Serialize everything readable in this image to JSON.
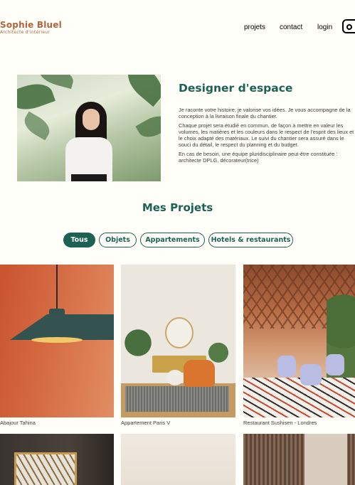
{
  "header": {
    "brand": "Sophie Bluel",
    "brand_subtitle": "Architecte d'intérieur",
    "nav": [
      "projets",
      "contact",
      "login"
    ],
    "social_icon": "instagram-icon"
  },
  "intro": {
    "title": "Designer d'espace",
    "paragraphs": [
      "Je raconte votre histoire, je valorise vos idées. Je vous accompagne de la conception à la livraison finale du chantier.",
      "Chaque projet sera étudié en commun, de façon à mettre en valeur les volumes, les matières et les couleurs dans le respect de l'esprit des lieux et le choix adapté des matériaux. Le suivi du chantier sera assuré dans le souci du détail, le respect du planning et du budget.",
      "En cas de besoin, une équipe pluridisciplinaire peut-être constituée : architecte DPLG, décorateur(trice)"
    ]
  },
  "projects": {
    "title": "Mes Projets",
    "filters": [
      "Tous",
      "Objets",
      "Appartements",
      "Hotels & restaurants"
    ],
    "active_filter": "Tous",
    "items": [
      {
        "caption": "Abajour Tahina"
      },
      {
        "caption": "Appartement Paris V"
      },
      {
        "caption": "Restaurant Sushisen - Londres"
      }
    ]
  },
  "colors": {
    "accent": "#1D6154",
    "brand": "#B1663C",
    "background": "#FFFEF8"
  }
}
